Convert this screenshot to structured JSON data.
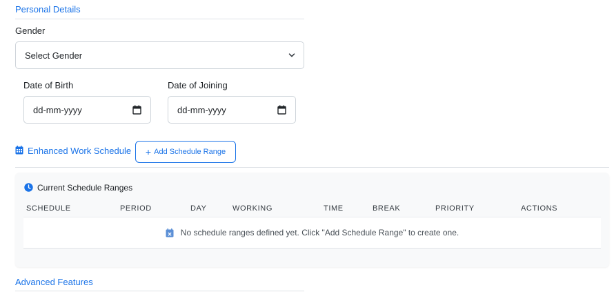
{
  "personal_details": {
    "title": "Personal Details"
  },
  "gender": {
    "label": "Gender",
    "selected": "Select Gender"
  },
  "dob": {
    "label": "Date of Birth",
    "placeholder": "dd-mm-yyyy"
  },
  "doj": {
    "label": "Date of Joining",
    "placeholder": "dd-mm-yyyy"
  },
  "work_schedule": {
    "title": "Enhanced Work Schedule",
    "add_button": "Add Schedule Range",
    "add_icon": "+"
  },
  "schedule_card": {
    "title": "Current Schedule Ranges",
    "columns": [
      "SCHEDULE",
      "PERIOD",
      "DAY",
      "WORKING",
      "TIME",
      "BREAK",
      "PRIORITY",
      "ACTIONS"
    ],
    "empty_message": "No schedule ranges defined yet. Click \"Add Schedule Range\" to create one."
  },
  "advanced": {
    "title": "Advanced Features"
  },
  "colors": {
    "accent": "#1a73e8",
    "card_bg": "#f8f9fa",
    "border": "#ced4da"
  },
  "icons": [
    "chevron-down-icon",
    "calendar-icon",
    "calendar-grid-icon",
    "clock-icon",
    "calendar-x-icon"
  ]
}
